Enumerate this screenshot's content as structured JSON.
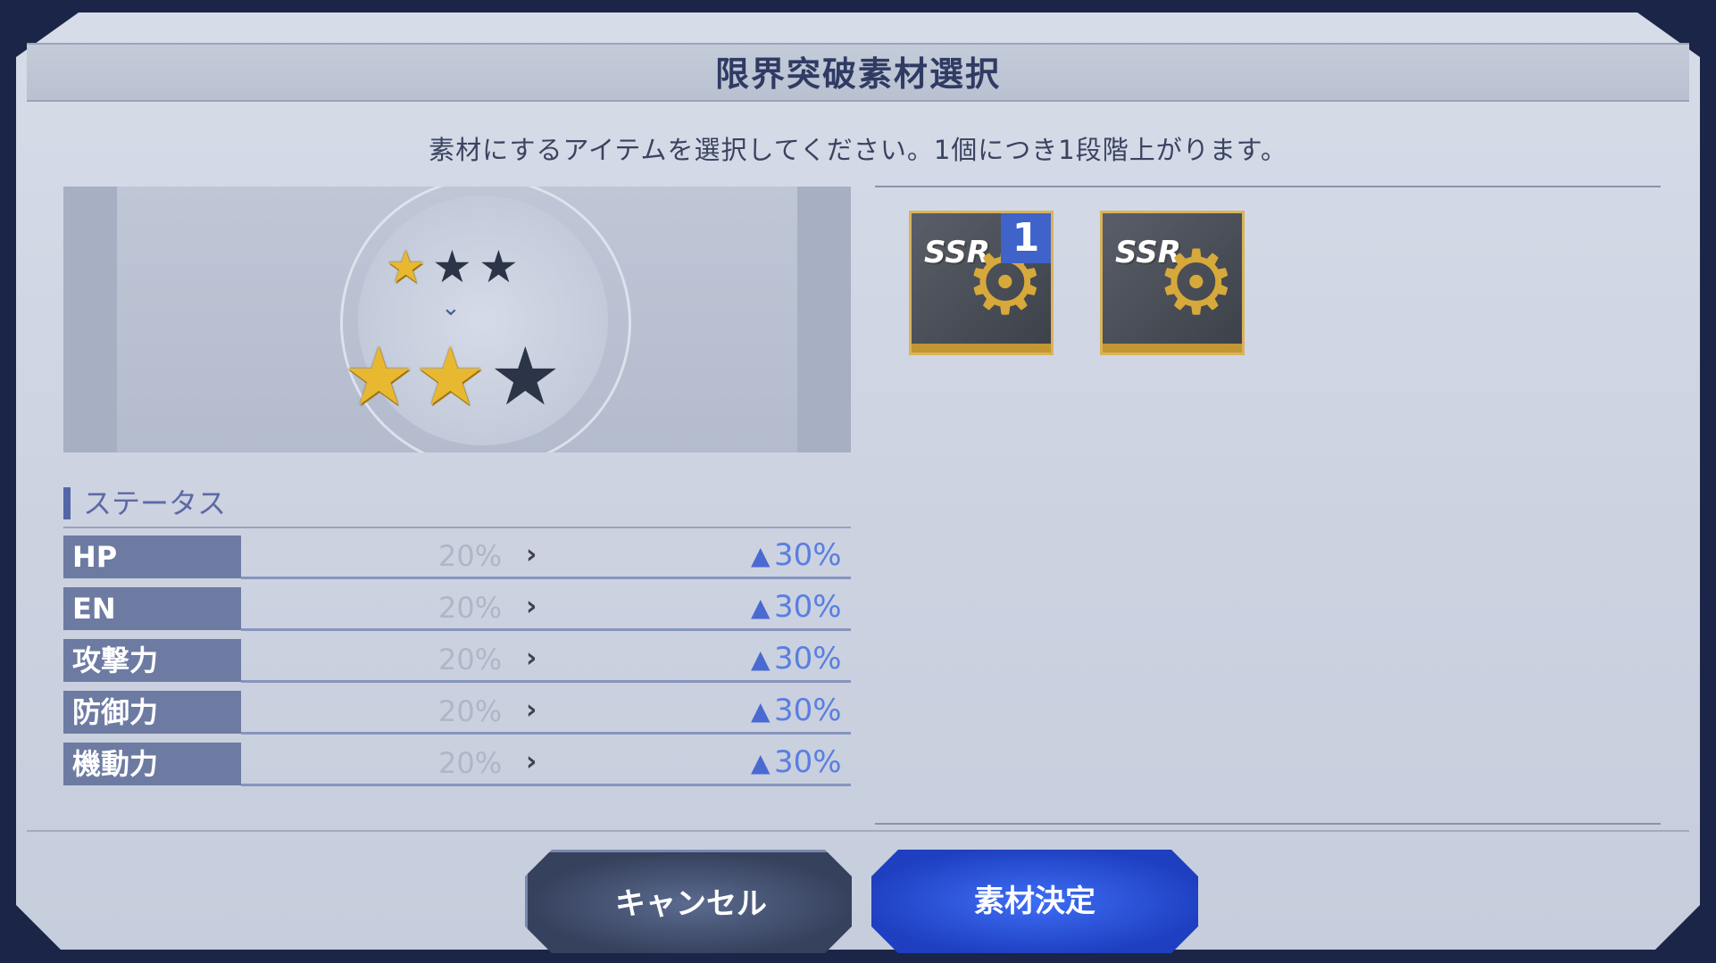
{
  "dialog": {
    "title": "限界突破素材選択",
    "instruction": "素材にするアイテムを選択してください。1個につき1段階上がります。"
  },
  "preview": {
    "before_stars": {
      "filled": 1,
      "total": 3
    },
    "after_stars": {
      "filled": 2,
      "total": 3
    }
  },
  "status": {
    "heading": "ステータス",
    "rows": [
      {
        "label": "HP",
        "current": "20%",
        "next": "30%"
      },
      {
        "label": "EN",
        "current": "20%",
        "next": "30%"
      },
      {
        "label": "攻撃力",
        "current": "20%",
        "next": "30%"
      },
      {
        "label": "防御力",
        "current": "20%",
        "next": "30%"
      },
      {
        "label": "機動力",
        "current": "20%",
        "next": "30%"
      }
    ]
  },
  "materials": [
    {
      "rarity": "SSR",
      "icon": "gear-icon",
      "selected_count": "1"
    },
    {
      "rarity": "SSR",
      "icon": "gear-icon",
      "selected_count": ""
    }
  ],
  "buttons": {
    "cancel": "キャンセル",
    "confirm": "素材決定"
  },
  "colors": {
    "accent_blue": "#3f63c8",
    "gold": "#e8b830",
    "panel": "#cdd3e1"
  }
}
